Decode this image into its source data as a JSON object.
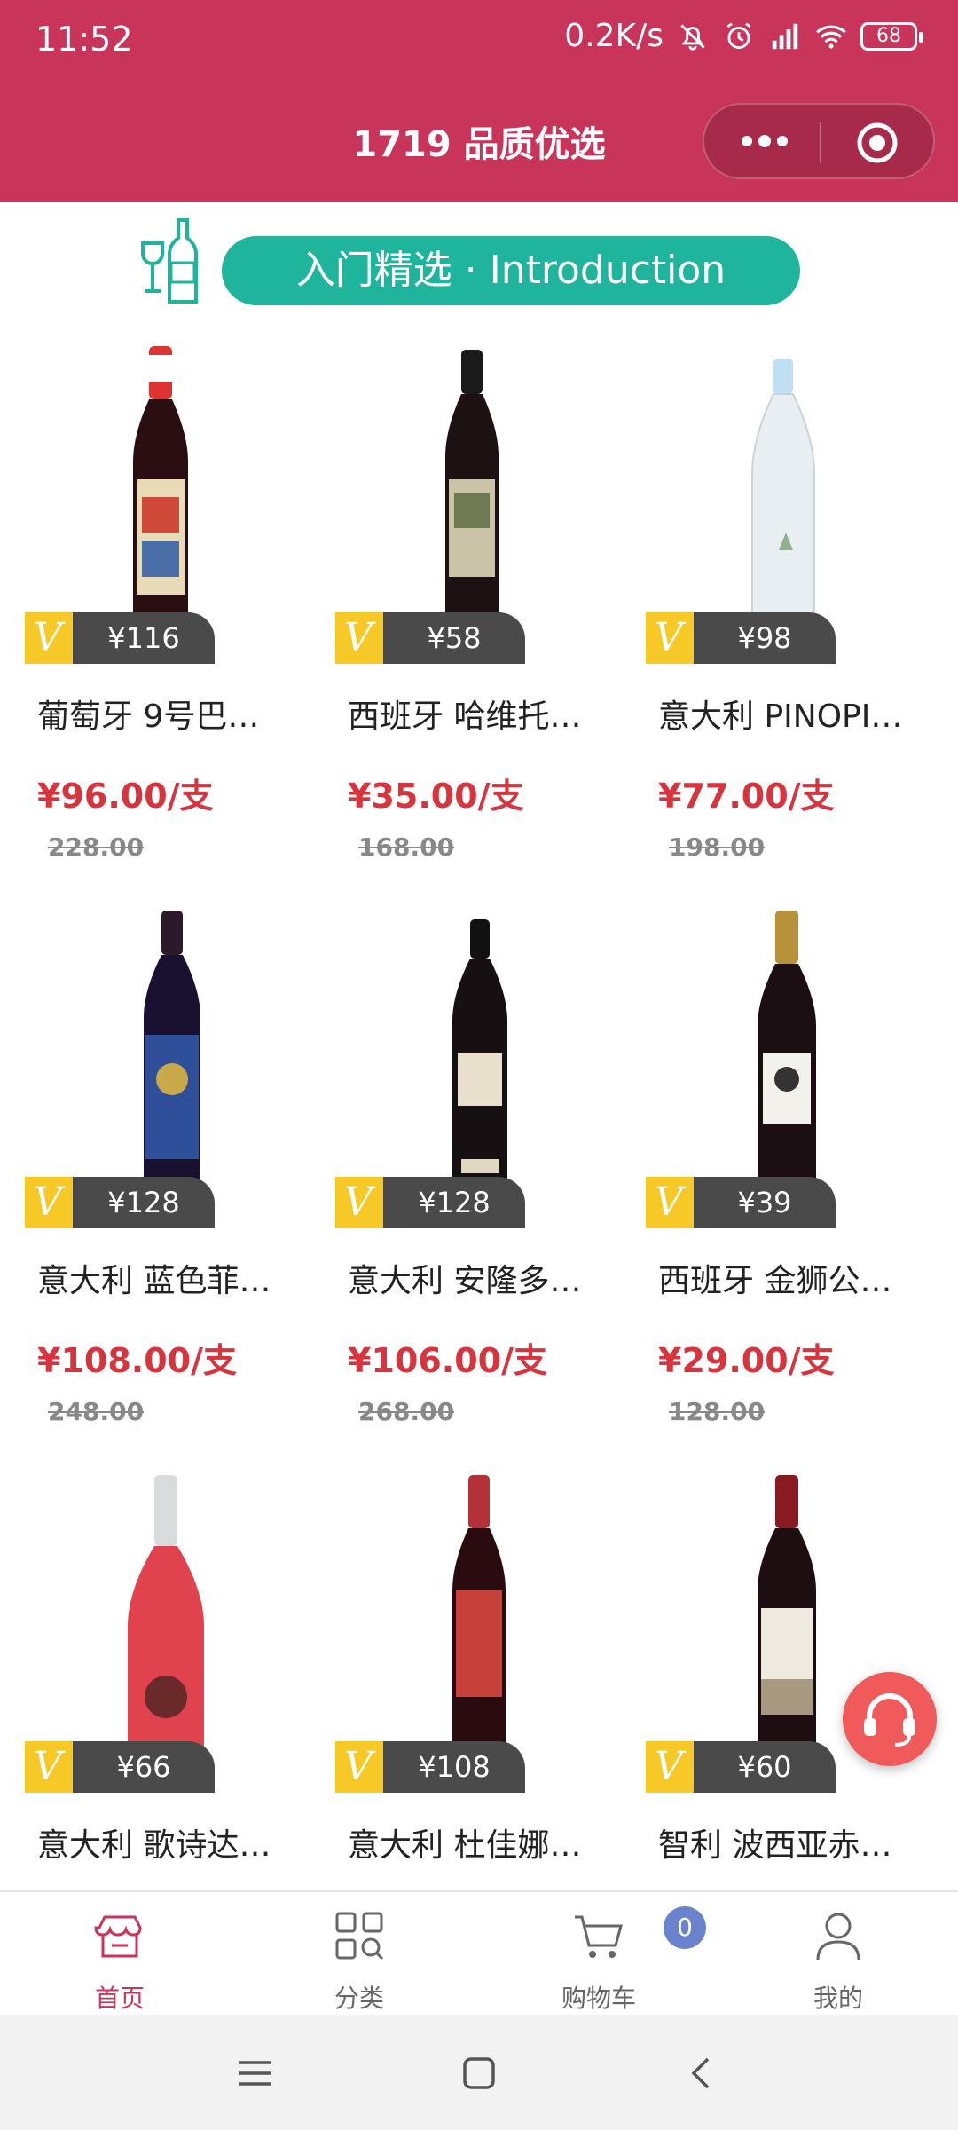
{
  "status_bar": {
    "time": "11:52",
    "speed": "0.2K/s",
    "battery": "68"
  },
  "header": {
    "title": "1719 品质优选"
  },
  "banner": {
    "text": "入门精选 · Introduction"
  },
  "products": [
    {
      "name": "葡萄牙 9号巴…",
      "member_price": "¥116",
      "price": "¥96.00/支",
      "original_price": "228.00"
    },
    {
      "name": "西班牙 哈维托…",
      "member_price": "¥58",
      "price": "¥35.00/支",
      "original_price": "168.00"
    },
    {
      "name": "意大利 PINOPI…",
      "member_price": "¥98",
      "price": "¥77.00/支",
      "original_price": "198.00"
    },
    {
      "name": "意大利 蓝色菲…",
      "member_price": "¥128",
      "price": "¥108.00/支",
      "original_price": "248.00"
    },
    {
      "name": "意大利 安隆多…",
      "member_price": "¥128",
      "price": "¥106.00/支",
      "original_price": "268.00"
    },
    {
      "name": "西班牙 金狮公…",
      "member_price": "¥39",
      "price": "¥29.00/支",
      "original_price": "128.00"
    },
    {
      "name": "意大利 歌诗达…",
      "member_price": "¥66",
      "price": "",
      "original_price": ""
    },
    {
      "name": "意大利 杜佳娜…",
      "member_price": "¥108",
      "price": "",
      "original_price": ""
    },
    {
      "name": "智利 波西亚赤…",
      "member_price": "¥60",
      "price": "",
      "original_price": ""
    }
  ],
  "member_badge": "V",
  "tabbar": {
    "home": "首页",
    "category": "分类",
    "cart": "购物车",
    "cart_count": "0",
    "mine": "我的"
  },
  "colors": {
    "brand": "#c8345a",
    "accent_green": "#1eb59c",
    "price_red": "#d8343e",
    "badge_yellow": "#f7c927"
  },
  "icons": [
    "bell-off-icon",
    "alarm-icon",
    "signal-icon",
    "wifi-icon",
    "battery-icon",
    "more-dots-icon",
    "close-target-icon",
    "wine-glass-icon",
    "customer-service-icon",
    "store-icon",
    "grid-search-icon",
    "cart-icon",
    "user-icon",
    "menu-icon",
    "home-square-icon",
    "back-icon"
  ]
}
